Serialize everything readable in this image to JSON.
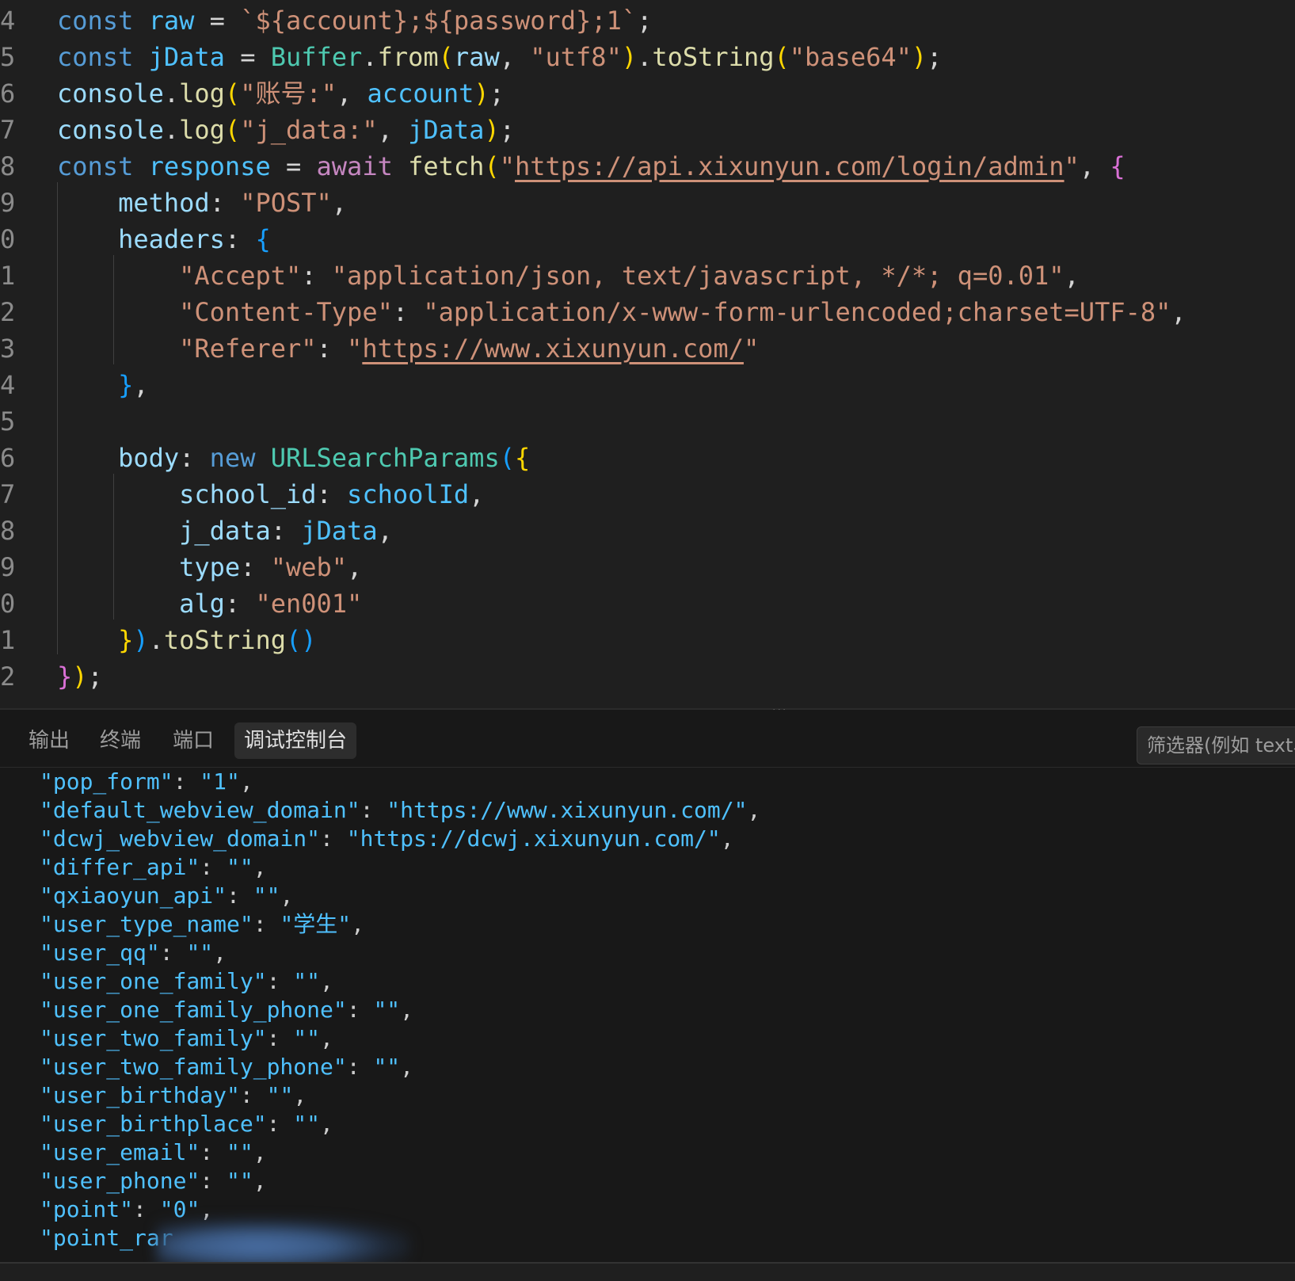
{
  "editor": {
    "lines": [
      {
        "num": "4"
      },
      {
        "num": "5"
      },
      {
        "num": "6"
      },
      {
        "num": "7"
      },
      {
        "num": "8"
      },
      {
        "num": "9"
      },
      {
        "num": "0"
      },
      {
        "num": "1"
      },
      {
        "num": "2"
      },
      {
        "num": "3"
      },
      {
        "num": "4"
      },
      {
        "num": "5"
      },
      {
        "num": "6"
      },
      {
        "num": "7"
      },
      {
        "num": "8"
      },
      {
        "num": "9"
      },
      {
        "num": "0"
      },
      {
        "num": "1"
      },
      {
        "num": "2"
      }
    ],
    "tokens": {
      "const": "const",
      "raw": "raw",
      "raw_template": "`${account};${password};1`",
      "jData": "jData",
      "Buffer": "Buffer",
      "from": "from",
      "utf8": "\"utf8\"",
      "toString": "toString",
      "base64": "\"base64\"",
      "console": "console",
      "log": "log",
      "account_label": "\"账号:\"",
      "account": "account",
      "jdata_label": "\"j_data:\"",
      "response": "response",
      "await": "await",
      "fetch": "fetch",
      "url_login": "https://api.xixunyun.com/login/admin",
      "method": "method",
      "post": "\"POST\"",
      "headers": "headers",
      "accept_key": "\"Accept\"",
      "accept_val": "\"application/json, text/javascript, */*; q=0.01\"",
      "ctype_key": "\"Content-Type\"",
      "ctype_val": "\"application/x-www-form-urlencoded;charset=UTF-8\"",
      "referer_key": "\"Referer\"",
      "referer_url": "https://www.xixunyun.com/",
      "body": "body",
      "new": "new",
      "URLSearchParams": "URLSearchParams",
      "school_id": "school_id",
      "schoolId": "schoolId",
      "j_data": "j_data",
      "type": "type",
      "web": "\"web\"",
      "alg": "alg",
      "en001": "\"en001\""
    }
  },
  "panel": {
    "tabs": [
      "输出",
      "终端",
      "端口",
      "调试控制台"
    ],
    "active_tab": "调试控制台",
    "filter_placeholder": "筛选器(例如 text、"
  },
  "console": {
    "entries": [
      {
        "key": "\"pop_form\"",
        "value": "\"1\""
      },
      {
        "key": "\"default_webview_domain\"",
        "value": "\"https://www.xixunyun.com/\""
      },
      {
        "key": "\"dcwj_webview_domain\"",
        "value": "\"https://dcwj.xixunyun.com/\""
      },
      {
        "key": "\"differ_api\"",
        "value": "\"\""
      },
      {
        "key": "\"qxiaoyun_api\"",
        "value": "\"\""
      },
      {
        "key": "\"user_type_name\"",
        "value": "\"学生\""
      },
      {
        "key": "\"user_qq\"",
        "value": "\"\""
      },
      {
        "key": "\"user_one_family\"",
        "value": "\"\""
      },
      {
        "key": "\"user_one_family_phone\"",
        "value": "\"\""
      },
      {
        "key": "\"user_two_family\"",
        "value": "\"\""
      },
      {
        "key": "\"user_two_family_phone\"",
        "value": "\"\""
      },
      {
        "key": "\"user_birthday\"",
        "value": "\"\""
      },
      {
        "key": "\"user_birthplace\"",
        "value": "\"\""
      },
      {
        "key": "\"user_email\"",
        "value": "\"\""
      },
      {
        "key": "\"user_phone\"",
        "value": "\"\""
      },
      {
        "key": "\"point\"",
        "value": "\"0\""
      }
    ],
    "partial_line": "\"point_rar"
  }
}
